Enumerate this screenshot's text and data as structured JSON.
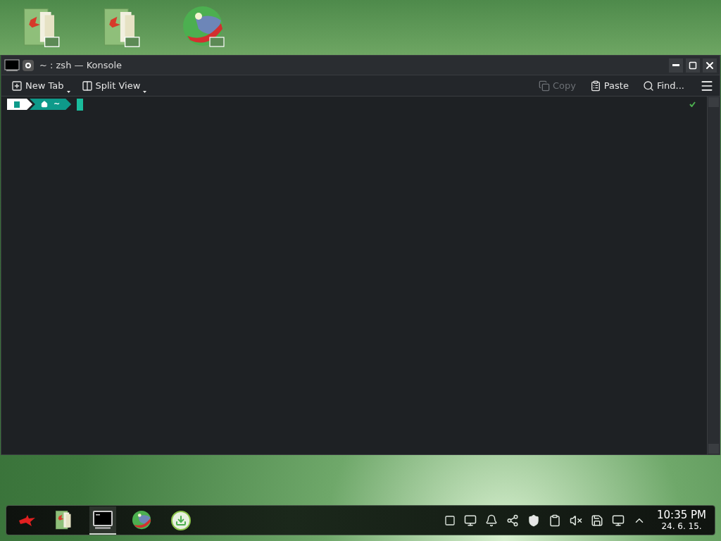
{
  "window": {
    "title": "~ : zsh — Konsole"
  },
  "toolbar": {
    "left": [
      {
        "kind": "new-tab",
        "label": "New Tab",
        "disabled": false
      },
      {
        "kind": "split",
        "label": "Split View",
        "disabled": false
      }
    ],
    "right": [
      {
        "kind": "copy",
        "label": "Copy",
        "disabled": true
      },
      {
        "kind": "paste",
        "label": "Paste",
        "disabled": false
      },
      {
        "kind": "find",
        "label": "Find...",
        "disabled": false
      }
    ]
  },
  "prompt": {
    "path": "~",
    "status_ok": true
  },
  "taskbar": {
    "tasks": [
      {
        "kind": "launcher",
        "active": false
      },
      {
        "kind": "folder",
        "active": false
      },
      {
        "kind": "terminal",
        "active": true
      },
      {
        "kind": "globe",
        "active": false
      },
      {
        "kind": "download",
        "active": false
      }
    ],
    "clock": {
      "time": "10:35 PM",
      "date": "24. 6. 15."
    }
  }
}
